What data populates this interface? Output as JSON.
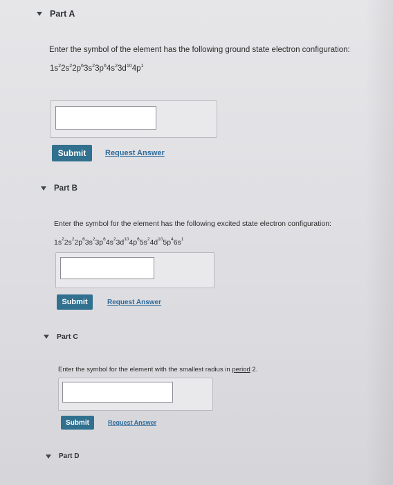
{
  "parts": [
    {
      "title": "Part A",
      "question": "Enter the symbol of the element has the following ground state electron configuration:",
      "config": [
        [
          "1s",
          "2"
        ],
        [
          "2s",
          "2"
        ],
        [
          "2p",
          "6"
        ],
        [
          "3s",
          "2"
        ],
        [
          "3p",
          "6"
        ],
        [
          "4s",
          "2"
        ],
        [
          "3d",
          "10"
        ],
        [
          "4p",
          "1"
        ]
      ],
      "input_value": "",
      "submit_label": "Submit",
      "request_label": "Request Answer"
    },
    {
      "title": "Part B",
      "question": "Enter the symbol for the element has the following excited state electron configuration:",
      "config": [
        [
          "1s",
          "2"
        ],
        [
          "2s",
          "2"
        ],
        [
          "2p",
          "6"
        ],
        [
          "3s",
          "2"
        ],
        [
          "3p",
          "6"
        ],
        [
          "4s",
          "2"
        ],
        [
          "3d",
          "10"
        ],
        [
          "4p",
          "6"
        ],
        [
          "5s",
          "2"
        ],
        [
          "4d",
          "10"
        ],
        [
          "5p",
          "4"
        ],
        [
          "6s",
          "1"
        ]
      ],
      "input_value": "",
      "submit_label": "Submit",
      "request_label": "Request Answer"
    },
    {
      "title": "Part C",
      "question": "Enter the symbol for the element with the smallest radius in period 2.",
      "input_value": "",
      "submit_label": "Submit",
      "request_label": "Request Answer"
    },
    {
      "title": "Part D"
    }
  ]
}
